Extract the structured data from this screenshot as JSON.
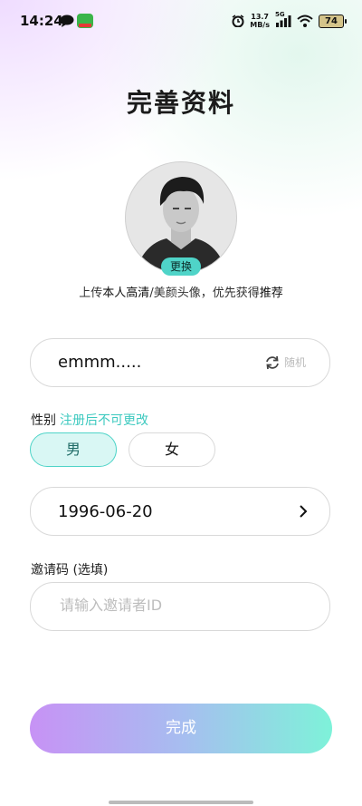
{
  "status_bar": {
    "time": "14:24",
    "net_speed_value": "13.7",
    "net_speed_unit": "MB/s",
    "network_type": "5G",
    "battery": "74"
  },
  "page": {
    "title": "完善资料"
  },
  "avatar": {
    "change_label": "更换",
    "hint_prefix": "上传",
    "hint_bold1": "本人高清",
    "hint_mid": "/美颜头像，优先获得",
    "hint_bold2": "推荐"
  },
  "nickname": {
    "value": "emmm.....",
    "random_label": "随机"
  },
  "gender": {
    "label": "性别",
    "note": "注册后不可更改",
    "options": [
      "男",
      "女"
    ],
    "selected": "男"
  },
  "birthday": {
    "value": "1996-06-20"
  },
  "invite": {
    "label": "邀请码 (选填)",
    "placeholder": "请输入邀请者ID",
    "value": ""
  },
  "actions": {
    "done_label": "完成"
  },
  "colors": {
    "accent": "#4fd4c8",
    "gradient_start": "#c792f5",
    "gradient_end": "#7ef2d9"
  }
}
